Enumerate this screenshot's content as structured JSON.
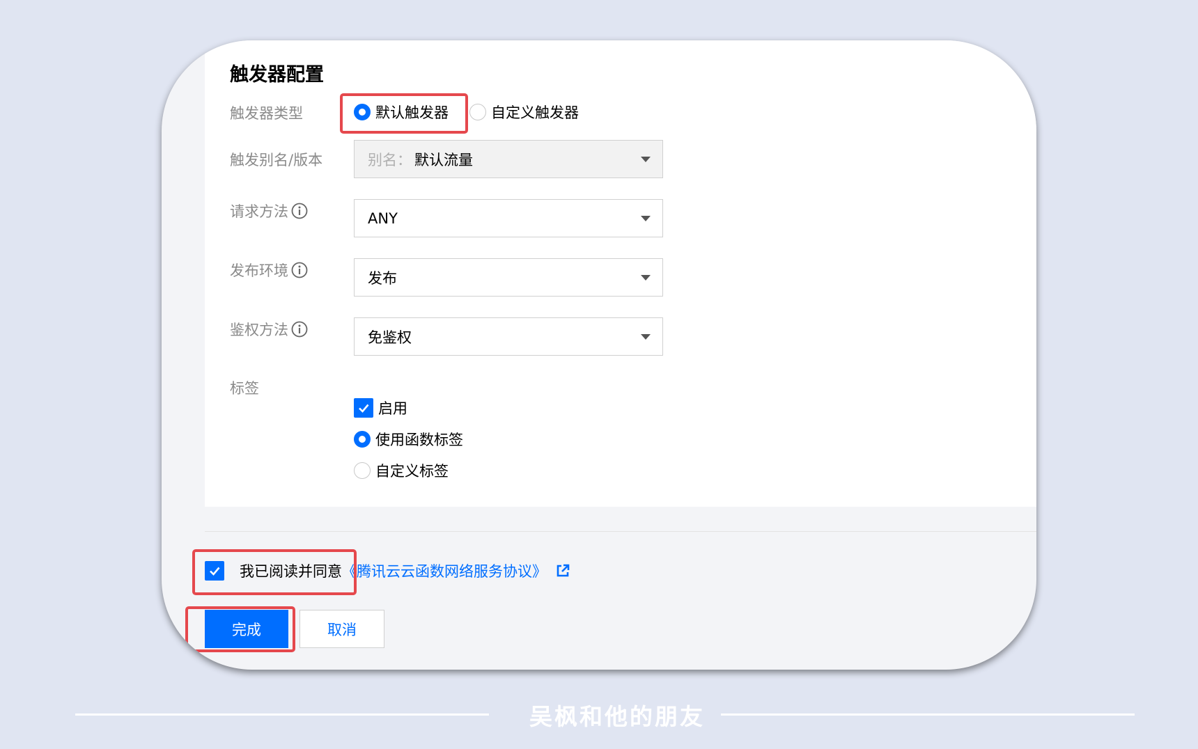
{
  "section": {
    "title": "触发器配置"
  },
  "trigger_type": {
    "label": "触发器类型",
    "options": [
      {
        "label": "默认触发器",
        "checked": true
      },
      {
        "label": "自定义触发器",
        "checked": false
      }
    ]
  },
  "alias": {
    "label": "触发别名/版本",
    "prefix": "别名：",
    "value": "默认流量",
    "disabled": true
  },
  "method": {
    "label": "请求方法",
    "value": "ANY"
  },
  "environment": {
    "label": "发布环境",
    "value": "发布"
  },
  "auth": {
    "label": "鉴权方法",
    "value": "免鉴权"
  },
  "tags": {
    "label": "标签",
    "enable_label": "启用",
    "enabled": true,
    "options": [
      {
        "label": "使用函数标签",
        "checked": true
      },
      {
        "label": "自定义标签",
        "checked": false
      }
    ]
  },
  "agreement": {
    "checked": true,
    "text": "我已阅读并同意",
    "link": "《腾讯云云函数网络服务协议》"
  },
  "buttons": {
    "confirm": "完成",
    "cancel": "取消"
  },
  "watermark": "吴枫和他的朋友",
  "colors": {
    "primary": "#006eff",
    "highlight": "#e5484d",
    "background": "#e0e5f2"
  }
}
